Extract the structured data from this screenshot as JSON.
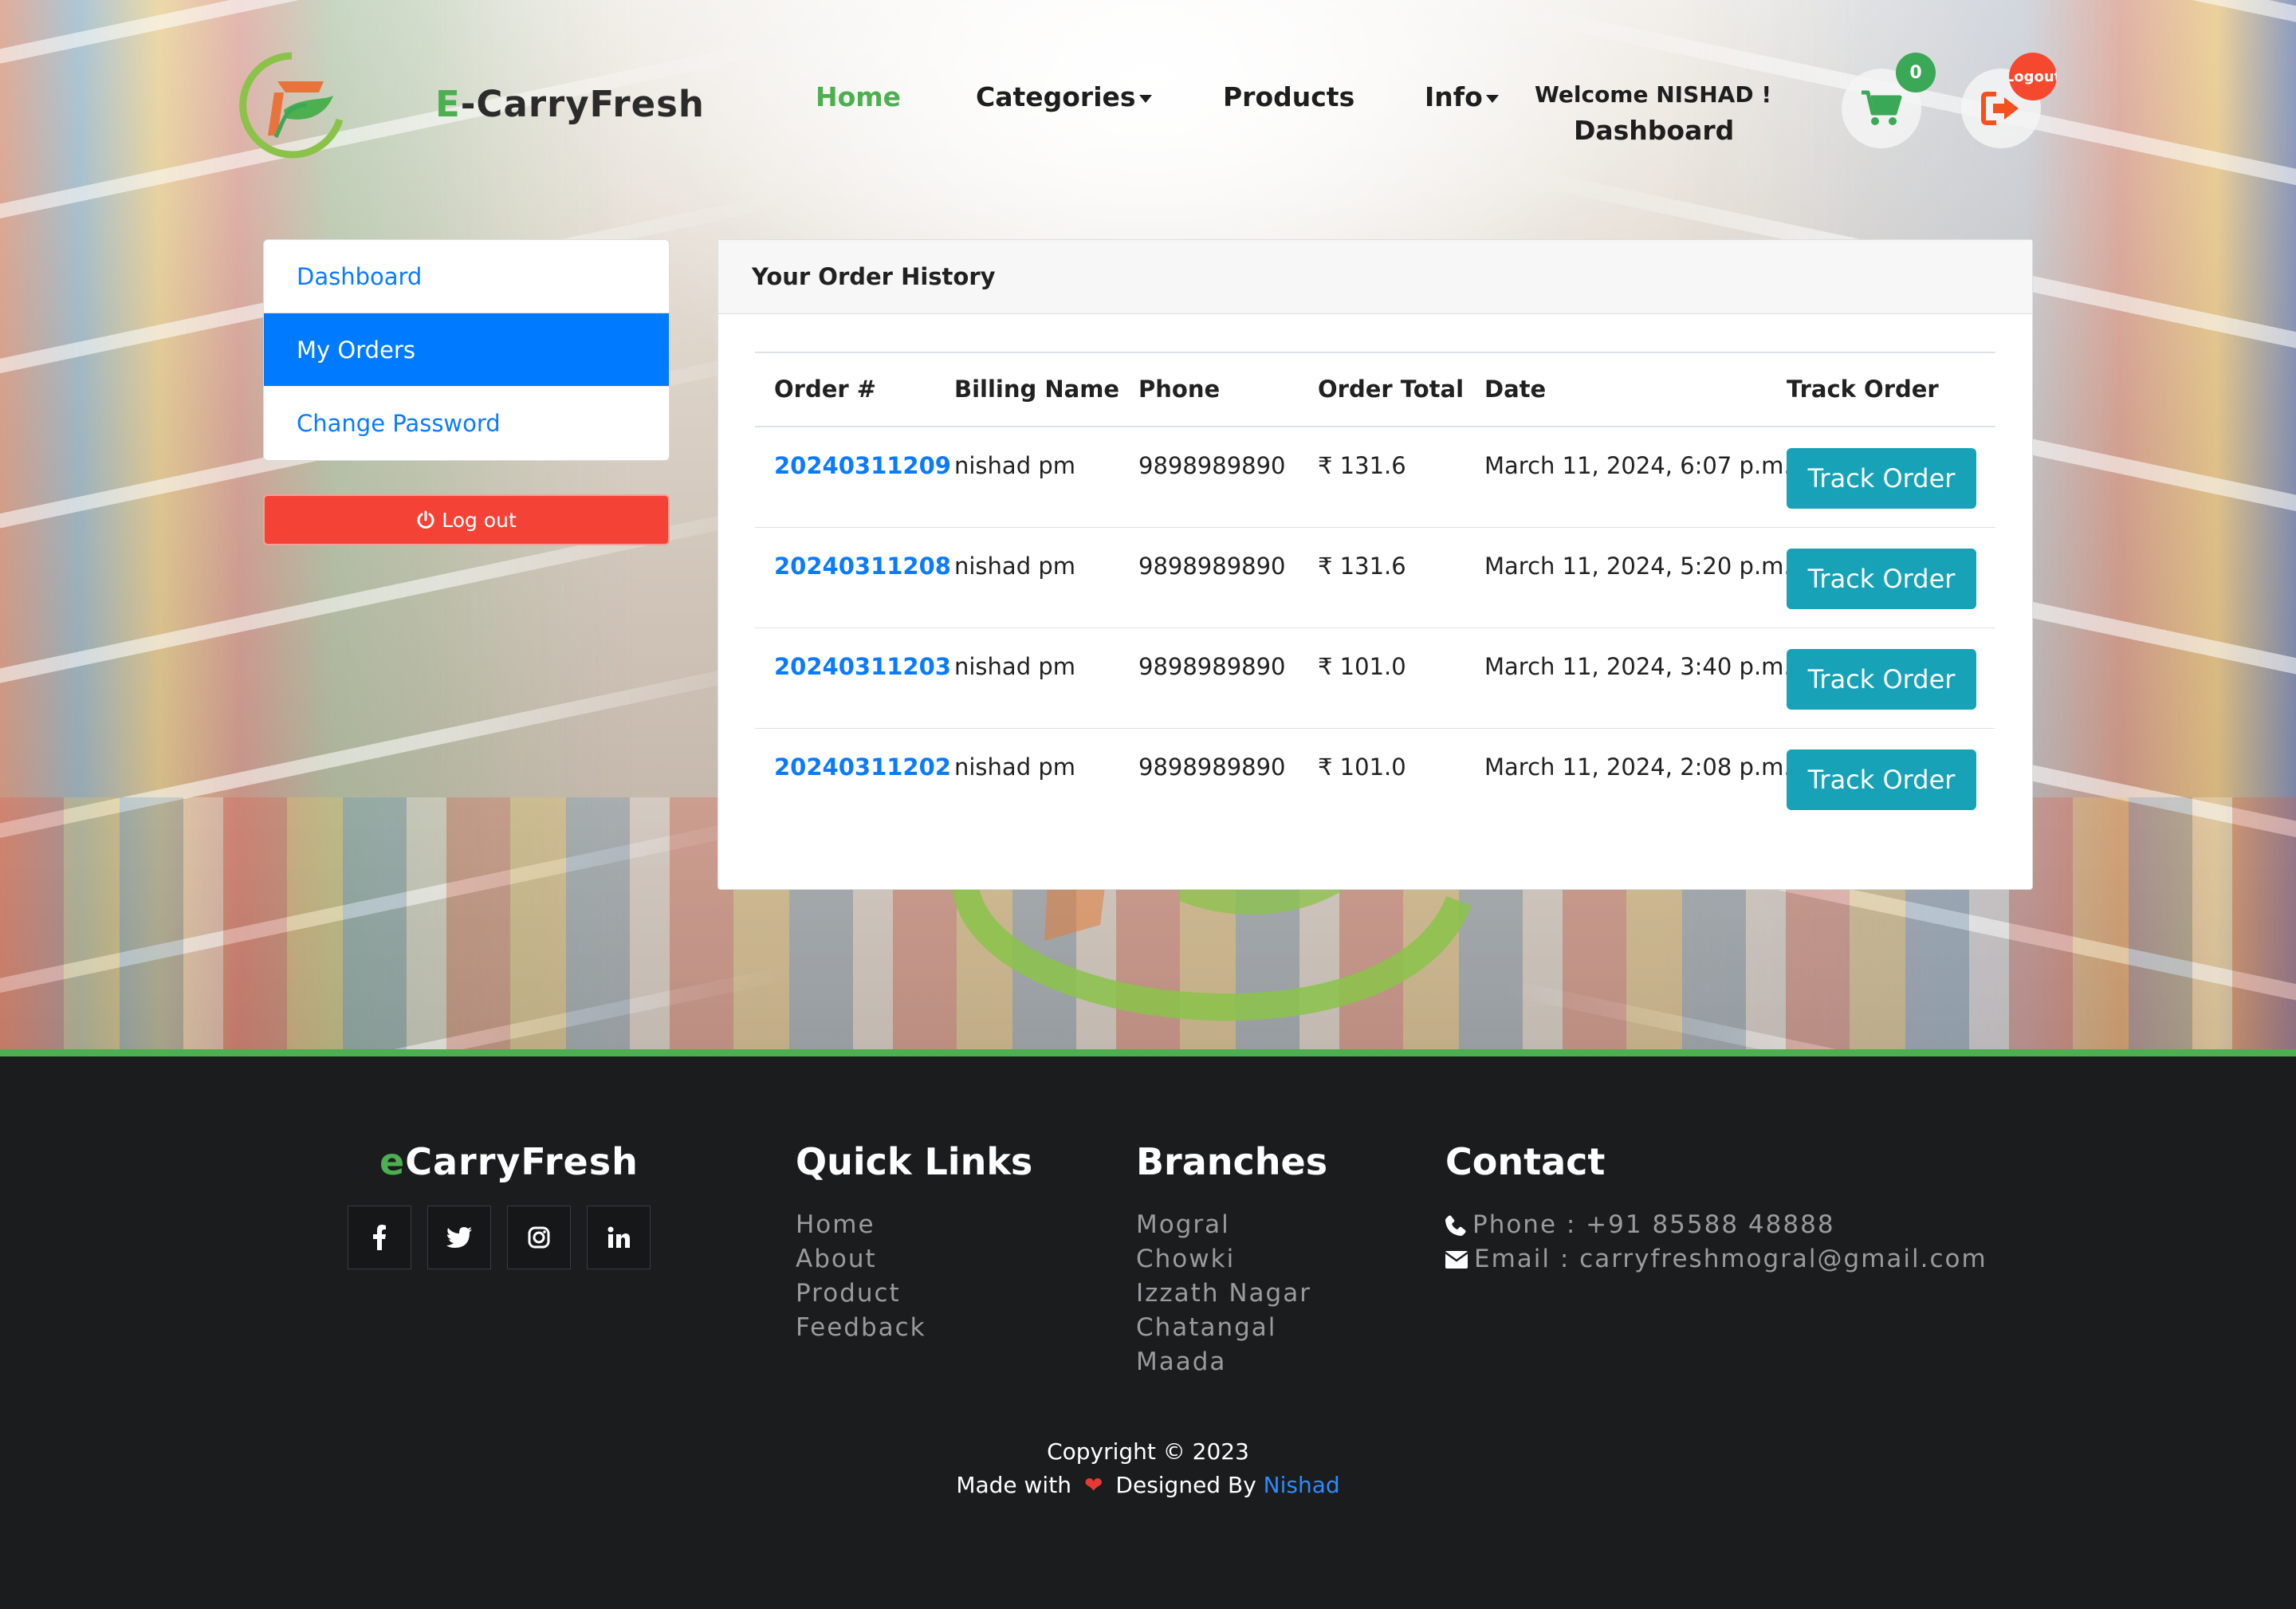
{
  "brand": {
    "name_accent": "E",
    "name_rest": "-CarryFresh"
  },
  "nav": {
    "home": "Home",
    "categories": "Categories",
    "products": "Products",
    "info": "Info",
    "welcome": "Welcome NISHAD !",
    "dashboard": "Dashboard",
    "cart_count": "0",
    "logout_badge": "Logout"
  },
  "sidebar": {
    "items": [
      "Dashboard",
      "My Orders",
      "Change Password"
    ],
    "active_item": "My Orders",
    "logout": "Log out"
  },
  "orders": {
    "title": "Your Order History",
    "columns": [
      "Order #",
      "Billing Name",
      "Phone",
      "Order Total",
      "Date",
      "Track Order"
    ],
    "rows": [
      {
        "order_no": "20240311209",
        "name": "nishad pm",
        "phone": "9898989890",
        "total": "₹ 131.6",
        "date": "March 11, 2024, 6:07 p.m.",
        "action": "Track Order"
      },
      {
        "order_no": "20240311208",
        "name": "nishad pm",
        "phone": "9898989890",
        "total": "₹ 131.6",
        "date": "March 11, 2024, 5:20 p.m.",
        "action": "Track Order"
      },
      {
        "order_no": "20240311203",
        "name": "nishad pm",
        "phone": "9898989890",
        "total": "₹ 101.0",
        "date": "March 11, 2024, 3:40 p.m.",
        "action": "Track Order"
      },
      {
        "order_no": "20240311202",
        "name": "nishad pm",
        "phone": "9898989890",
        "total": "₹ 101.0",
        "date": "March 11, 2024, 2:08 p.m.",
        "action": "Track Order"
      }
    ]
  },
  "footer": {
    "brand_accent": "e",
    "brand_rest": "CarryFresh",
    "social": [
      "facebook-icon",
      "twitter-icon",
      "instagram-icon",
      "linkedin-icon"
    ],
    "quick_links_title": "Quick Links",
    "quick_links": [
      "Home",
      "About",
      "Product",
      "Feedback"
    ],
    "branches_title": "Branches",
    "branches": [
      "Mogral",
      "Chowki",
      "Izzath Nagar",
      "Chatangal",
      "Maada"
    ],
    "contact_title": "Contact",
    "phone": "Phone : +91 85588 48888",
    "email": "Email : carryfreshmogral@gmail.com",
    "copyright": "Copyright © 2023",
    "made_with": "Made with",
    "designed_by": "Designed By",
    "author": "Nishad"
  },
  "colors": {
    "accent_green": "#4caf50",
    "primary_blue": "#007bff",
    "track_teal": "#17a2b8",
    "danger_red": "#f44336"
  }
}
